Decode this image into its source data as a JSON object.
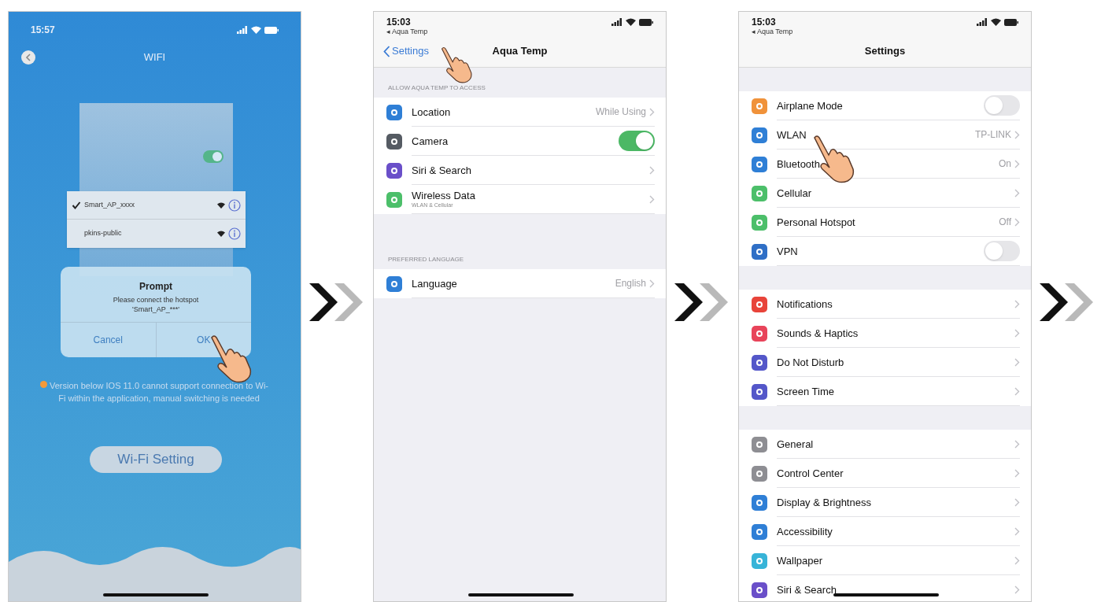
{
  "wifi_app": {
    "status_time": "15:57",
    "title": "WIFI",
    "illustration_toggle": {
      "on": true
    },
    "networks": [
      {
        "name": "Smart_AP_xxxx",
        "selected": true
      },
      {
        "name": "pkins-public",
        "selected": false
      }
    ],
    "dialog": {
      "title": "Prompt",
      "message": "Please connect the hotspot 'Smart_AP_***'",
      "buttons": [
        "Cancel",
        "OK"
      ]
    },
    "note": "Version below IOS 11.0 cannot support connection to Wi-Fi within the application, manual switching is needed",
    "button": "Wi-Fi Setting"
  },
  "settings_screens": [
    {
      "status_time": "15:03",
      "back_app": "◂ Aqua Temp",
      "nav_back": "Settings",
      "title": "Aqua Temp",
      "groups": [
        {
          "header": "ALLOW AQUA TEMP TO ACCESS",
          "rows": [
            {
              "label": "Location",
              "value": "While Using",
              "kind": "chevron",
              "color": "#2f7fd6"
            },
            {
              "label": "Camera",
              "kind": "toggle",
              "on": true,
              "color": "#555b63"
            },
            {
              "label": "Siri & Search",
              "kind": "chevron",
              "color": "#6a4fc9"
            },
            {
              "label": "Wireless Data",
              "subtitle": "WLAN & Cellular",
              "kind": "chevron",
              "color": "#4cbf6a"
            }
          ]
        },
        {
          "header": "PREFERRED LANGUAGE",
          "rows": [
            {
              "label": "Language",
              "value": "English",
              "kind": "chevron",
              "color": "#2f7fd6"
            }
          ]
        }
      ]
    },
    {
      "status_time": "15:03",
      "back_app": "◂ Aqua Temp",
      "title": "Settings",
      "groups": [
        {
          "rows": [
            {
              "label": "Airplane Mode",
              "kind": "toggle",
              "on": false,
              "color": "#f0923a"
            },
            {
              "label": "WLAN",
              "value": "TP-LINK",
              "kind": "chevron",
              "color": "#2f7fd6"
            },
            {
              "label": "Bluetooth",
              "value": "On",
              "kind": "chevron",
              "color": "#2f7fd6"
            },
            {
              "label": "Cellular",
              "kind": "chevron",
              "color": "#4cbf6a"
            },
            {
              "label": "Personal Hotspot",
              "value": "Off",
              "kind": "chevron",
              "color": "#4cbf6a"
            },
            {
              "label": "VPN",
              "kind": "toggle",
              "on": false,
              "color": "#2f6fc6"
            }
          ]
        },
        {
          "rows": [
            {
              "label": "Notifications",
              "kind": "chevron",
              "color": "#e8443a"
            },
            {
              "label": "Sounds & Haptics",
              "kind": "chevron",
              "color": "#e8445a"
            },
            {
              "label": "Do Not Disturb",
              "kind": "chevron",
              "color": "#5457c9"
            },
            {
              "label": "Screen Time",
              "kind": "chevron",
              "color": "#5457c9"
            }
          ]
        },
        {
          "rows": [
            {
              "label": "General",
              "kind": "chevron",
              "color": "#8e8e93"
            },
            {
              "label": "Control Center",
              "kind": "chevron",
              "color": "#8e8e93"
            },
            {
              "label": "Display & Brightness",
              "kind": "chevron",
              "color": "#2f7fd6"
            },
            {
              "label": "Accessibility",
              "kind": "chevron",
              "color": "#2f7fd6"
            },
            {
              "label": "Wallpaper",
              "kind": "chevron",
              "color": "#37b4d8"
            },
            {
              "label": "Siri & Search",
              "kind": "chevron",
              "color": "#6a4fc9"
            }
          ]
        }
      ]
    }
  ]
}
